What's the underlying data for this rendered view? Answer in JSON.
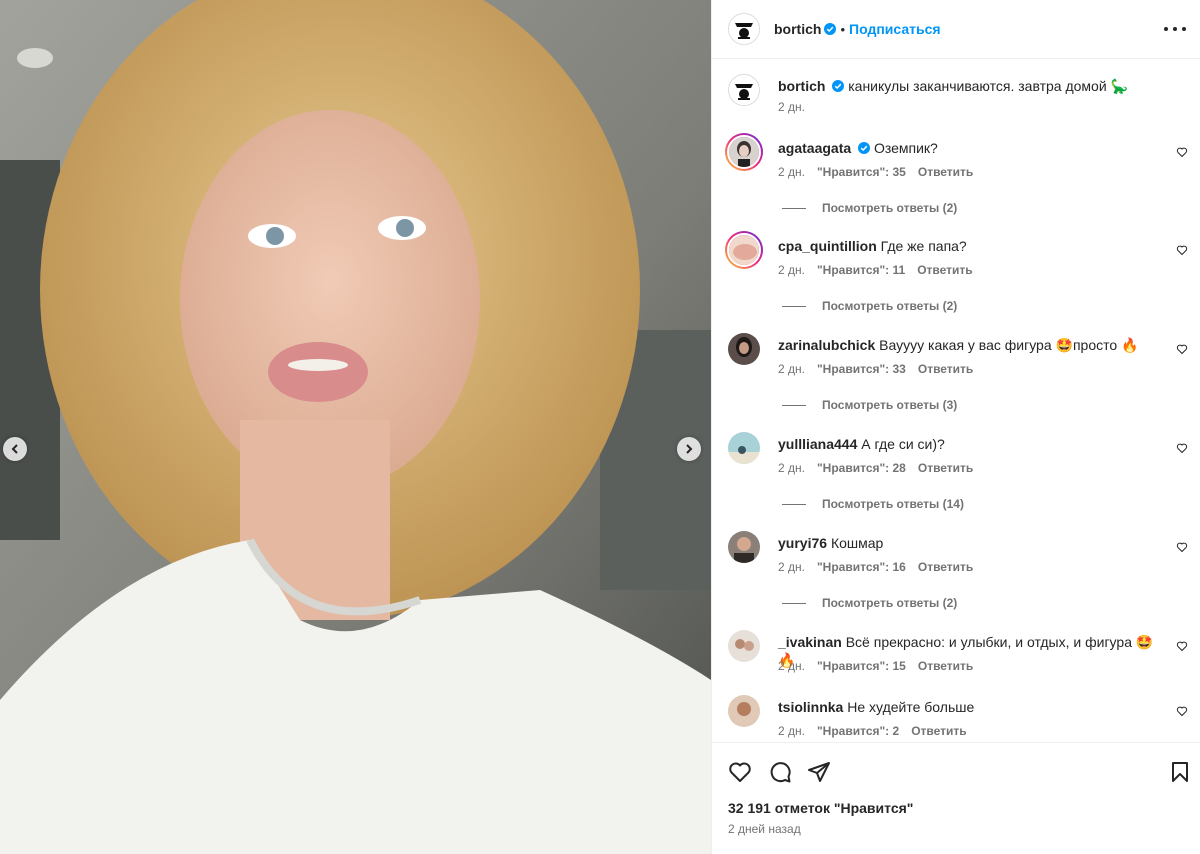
{
  "post": {
    "author": "bortich",
    "follow_label": "Подписаться",
    "dot": "•",
    "caption": "каникулы заканчиваются. завтра домой 🦕",
    "caption_time": "2 дн.",
    "likes": "32 191 отметок \"Нравится\"",
    "date": "2 дней назад"
  },
  "comments": [
    {
      "user": "agataagata",
      "verified": true,
      "text": "Оземпик?",
      "time": "2 дн.",
      "likes": "\"Нравится\": 35",
      "reply": "Ответить",
      "replies": "Посмотреть ответы (2)",
      "avatar_color": "#c9c2bf"
    },
    {
      "user": "cpa_quintillion",
      "verified": false,
      "text": "Где же папа?",
      "time": "2 дн.",
      "likes": "\"Нравится\": 11",
      "reply": "Ответить",
      "replies": "Посмотреть ответы (2)",
      "avatar_color": "#e9c7b7"
    },
    {
      "user": "zarinalubchick",
      "verified": false,
      "text": "Вауууу какая у вас фигура 🤩просто 🔥",
      "time": "2 дн.",
      "likes": "\"Нравится\": 33",
      "reply": "Ответить",
      "replies": "Посмотреть ответы (3)",
      "avatar_color": "#3b3130"
    },
    {
      "user": "yullliana444",
      "verified": false,
      "text": "А где си си)?",
      "time": "2 дн.",
      "likes": "\"Нравится\": 28",
      "reply": "Ответить",
      "replies": "Посмотреть ответы (14)",
      "avatar_color": "#9cc4c9"
    },
    {
      "user": "yuryi76",
      "verified": false,
      "text": "Кошмар",
      "time": "2 дн.",
      "likes": "\"Нравится\": 16",
      "reply": "Ответить",
      "replies": "Посмотреть ответы (2)",
      "avatar_color": "#6c6259"
    },
    {
      "user": "_ivakinan",
      "verified": false,
      "text": "Всё прекрасно: и улыбки, и отдых, и фигура 🤩🔥",
      "time": "2 дн.",
      "likes": "\"Нравится\": 15",
      "reply": "Ответить",
      "replies": "",
      "avatar_color": "#d9d2c9"
    },
    {
      "user": "tsiolinnka",
      "verified": false,
      "text": "Не худейте больше",
      "time": "2 дн.",
      "likes": "\"Нравится\": 2",
      "reply": "Ответить",
      "replies": "",
      "avatar_color": "#c5a48a"
    }
  ],
  "colors": {
    "accent": "#0095f6",
    "secondary_text": "#737373",
    "verified": "#0095f6"
  },
  "icons": [
    "chevron-left-icon",
    "chevron-right-icon",
    "verified-icon",
    "more-icon",
    "heart-icon",
    "comment-icon",
    "share-icon",
    "bookmark-icon"
  ]
}
